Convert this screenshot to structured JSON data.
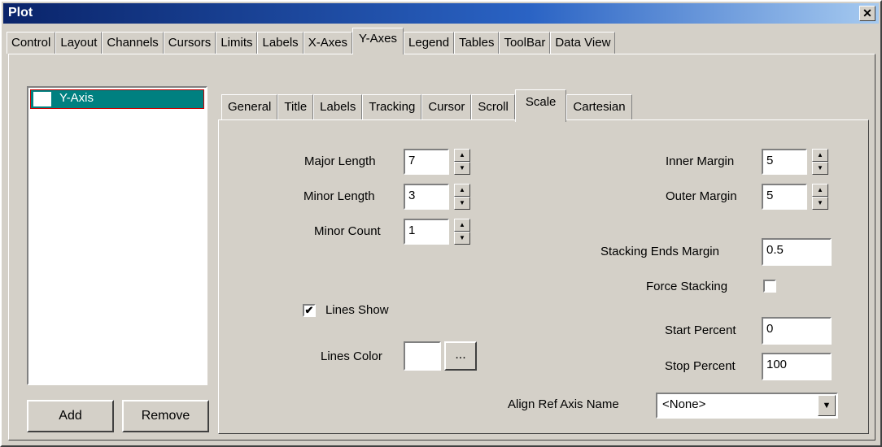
{
  "window": {
    "title": "Plot",
    "close_glyph": "✕"
  },
  "main_tabs": [
    "Control",
    "Layout",
    "Channels",
    "Cursors",
    "Limits",
    "Labels",
    "X-Axes",
    "Y-Axes",
    "Legend",
    "Tables",
    "ToolBar",
    "Data View"
  ],
  "active_main_tab": "Y-Axes",
  "axis_list": {
    "items": [
      {
        "label": "Y-Axis",
        "checked": false
      }
    ]
  },
  "buttons": {
    "add": "Add",
    "remove": "Remove"
  },
  "sub_tabs": [
    "General",
    "Title",
    "Labels",
    "Tracking",
    "Cursor",
    "Scroll",
    "Scale",
    "Cartesian"
  ],
  "active_sub_tab": "Scale",
  "scale": {
    "major_length_label": "Major Length",
    "major_length_value": "7",
    "minor_length_label": "Minor Length",
    "minor_length_value": "3",
    "minor_count_label": "Minor Count",
    "minor_count_value": "1",
    "lines_show_label": "Lines Show",
    "lines_show_checked": true,
    "lines_color_label": "Lines Color",
    "lines_color_button": "...",
    "inner_margin_label": "Inner Margin",
    "inner_margin_value": "5",
    "outer_margin_label": "Outer Margin",
    "outer_margin_value": "5",
    "stacking_ends_margin_label": "Stacking Ends Margin",
    "stacking_ends_margin_value": "0.5",
    "force_stacking_label": "Force Stacking",
    "force_stacking_checked": false,
    "start_percent_label": "Start Percent",
    "start_percent_value": "0",
    "stop_percent_label": "Stop Percent",
    "stop_percent_value": "100",
    "align_ref_axis_label": "Align Ref Axis Name",
    "align_ref_axis_value": "<None>"
  },
  "glyphs": {
    "up": "▲",
    "down": "▼",
    "check": "✔"
  }
}
